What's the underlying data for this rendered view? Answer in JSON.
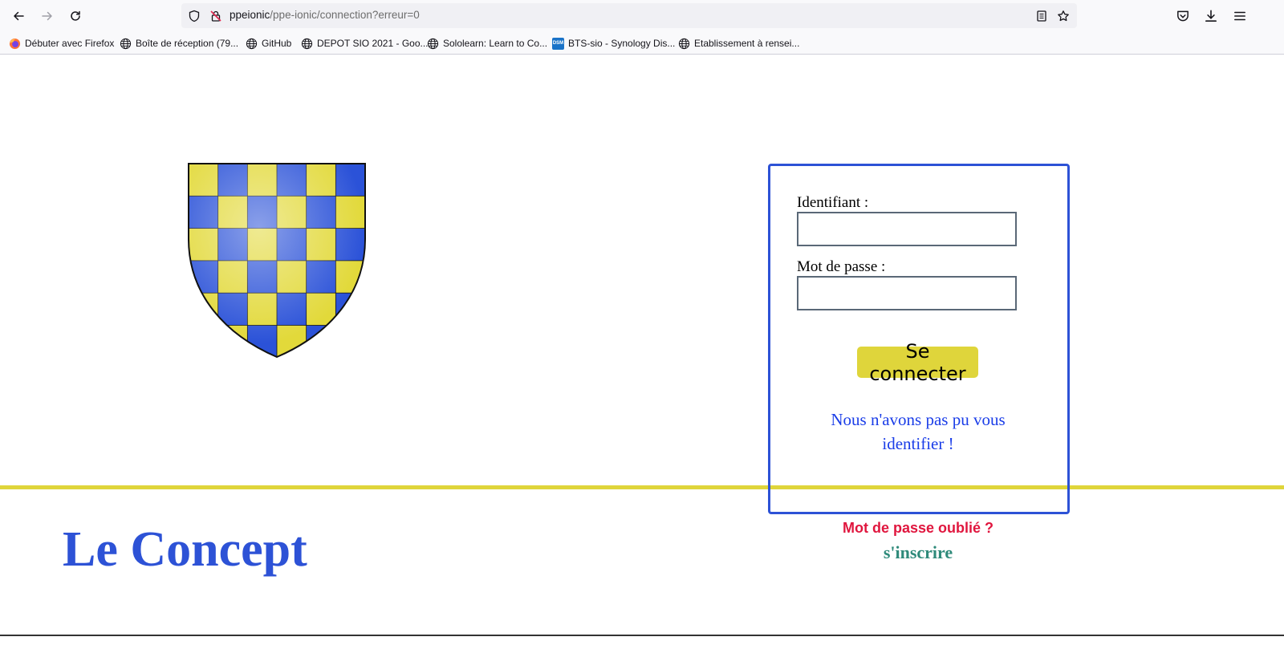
{
  "browser": {
    "url_host": "ppeionic",
    "url_path": "/ppe-ionic/connection?erreur=0",
    "icons": [
      "back-arrow-icon",
      "forward-arrow-icon",
      "reload-icon",
      "shield-icon",
      "insecure-lock-icon",
      "reader-view-icon",
      "bookmark-star-icon",
      "pocket-icon",
      "download-icon",
      "menu-icon"
    ]
  },
  "bookmarks": [
    {
      "label": "Débuter avec Firefox",
      "icon": "firefox-icon"
    },
    {
      "label": "Boîte de réception (79...",
      "icon": "globe-icon"
    },
    {
      "label": "GitHub",
      "icon": "globe-icon"
    },
    {
      "label": "DEPOT SIO 2021 - Goo...",
      "icon": "globe-icon"
    },
    {
      "label": "Sololearn: Learn to Co...",
      "icon": "globe-icon"
    },
    {
      "label": "BTS-sio - Synology Dis...",
      "icon": "dsm-icon",
      "icon_text": "DSM"
    },
    {
      "label": "Etablissement à rensei...",
      "icon": "globe-icon"
    }
  ],
  "page": {
    "title": "Le Concept",
    "login": {
      "username_label": "Identifiant :",
      "username_value": "",
      "password_label": "Mot de passe :",
      "password_value": "",
      "submit_label": "Se connecter",
      "error_message": "Nous n'avons pas pu vous identifier !"
    },
    "forgot_password": "Mot de passe oublié ?",
    "signup": "s'inscrire"
  },
  "colors": {
    "accent_blue": "#2d52d6",
    "accent_gold": "#dfd53b",
    "error_blue": "#1a3de8",
    "forgot_red": "#e0163e",
    "signup_teal": "#2e8a7a"
  }
}
